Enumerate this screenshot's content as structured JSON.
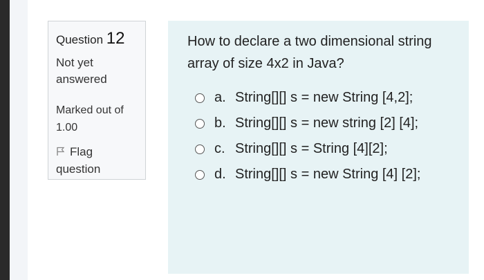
{
  "info": {
    "question_label": "Question",
    "question_number": "12",
    "state": "Not yet answered",
    "grade": "Marked out of 1.00",
    "flag_label": "Flag question"
  },
  "question": {
    "text": "How to declare a two dimensional string array of size 4x2 in Java?",
    "answers": [
      {
        "letter": "a.",
        "text": "String[][] s = new String [4,2];"
      },
      {
        "letter": "b.",
        "text": "String[][] s = new string [2] [4];"
      },
      {
        "letter": "c.",
        "text": "String[][] s = String [4][2];"
      },
      {
        "letter": "d.",
        "text": "String[][] s = new String [4] [2];"
      }
    ]
  }
}
